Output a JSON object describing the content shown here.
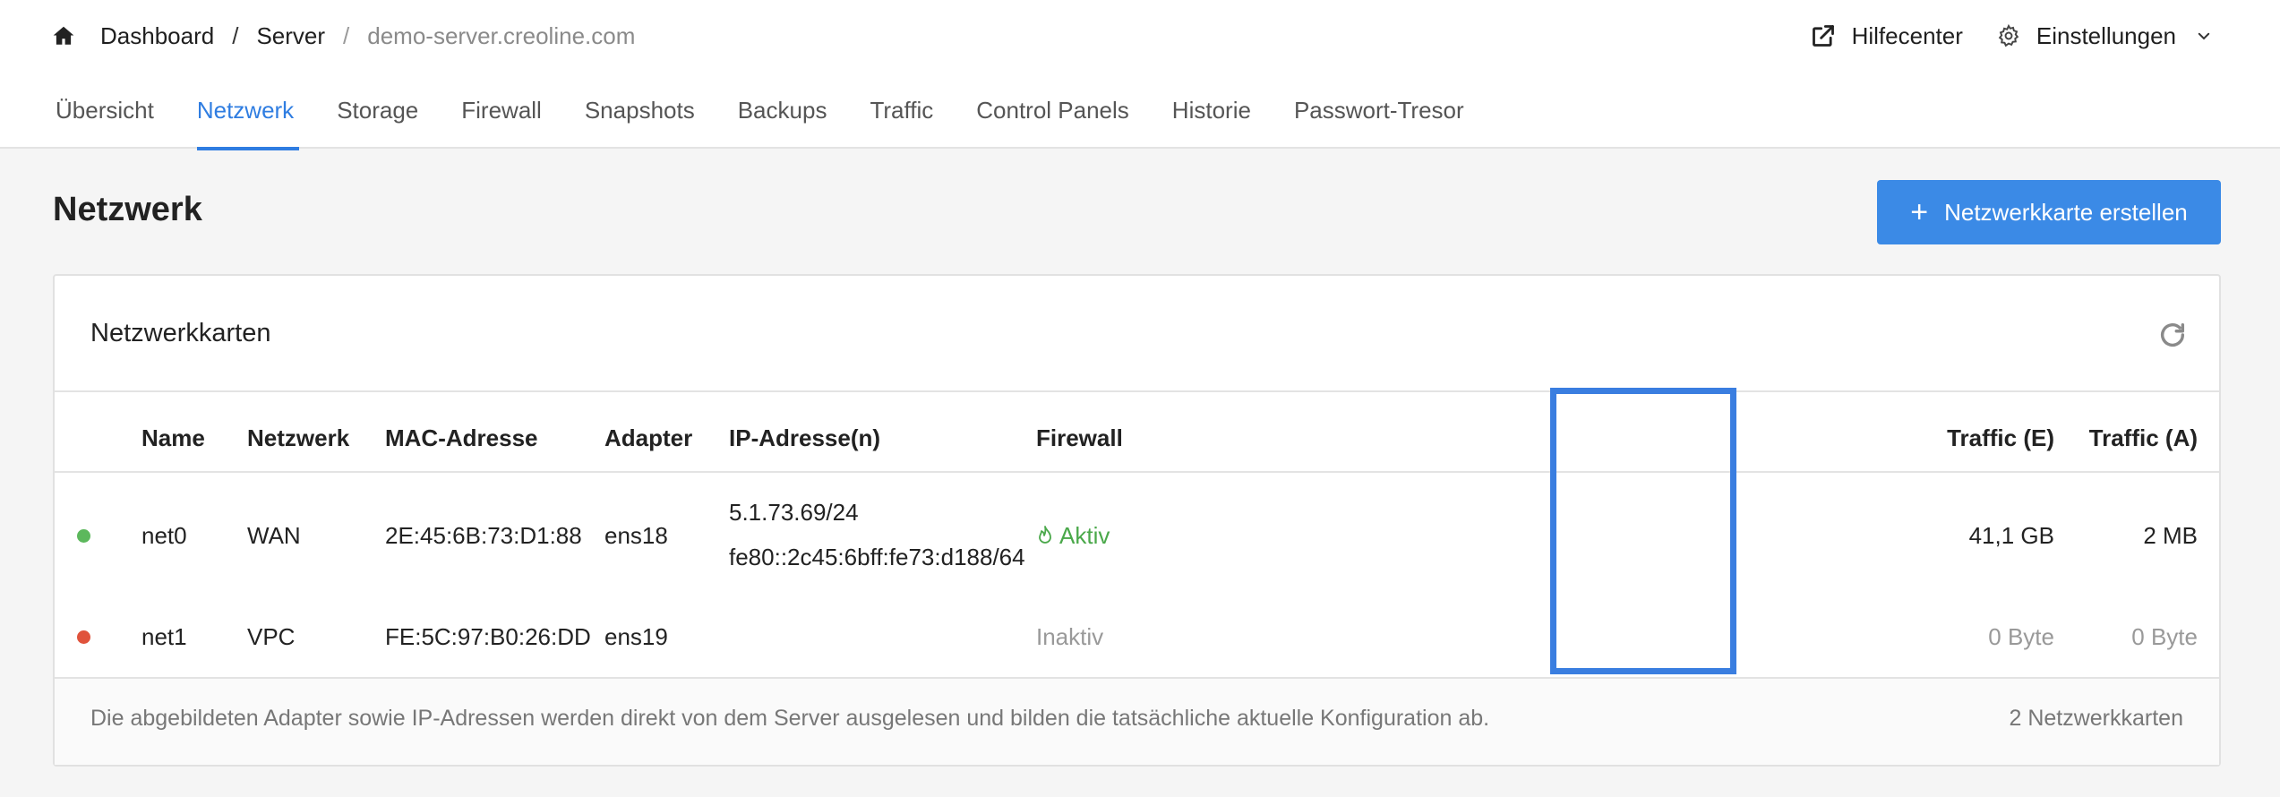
{
  "breadcrumb": {
    "items": [
      "Dashboard",
      "Server",
      "demo-server.creoline.com"
    ],
    "separator": "/"
  },
  "header_actions": {
    "help_label": "Hilfecenter",
    "settings_label": "Einstellungen"
  },
  "tabs": [
    {
      "label": "Übersicht",
      "active": false
    },
    {
      "label": "Netzwerk",
      "active": true
    },
    {
      "label": "Storage",
      "active": false
    },
    {
      "label": "Firewall",
      "active": false
    },
    {
      "label": "Snapshots",
      "active": false
    },
    {
      "label": "Backups",
      "active": false
    },
    {
      "label": "Traffic",
      "active": false
    },
    {
      "label": "Control Panels",
      "active": false
    },
    {
      "label": "Historie",
      "active": false
    },
    {
      "label": "Passwort-Tresor",
      "active": false
    }
  ],
  "page": {
    "title": "Netzwerk",
    "create_button_label": "Netzwerkkarte erstellen"
  },
  "card": {
    "title": "Netzwerkkarten",
    "columns": [
      "Name",
      "Netzwerk",
      "MAC-Adresse",
      "Adapter",
      "IP-Adresse(n)",
      "Firewall",
      "Traffic (E)",
      "Traffic (A)"
    ],
    "rows": [
      {
        "status_color": "#5cb85c",
        "name": "net0",
        "network": "WAN",
        "mac": "2E:45:6B:73:D1:88",
        "adapter": "ens18",
        "ips": [
          "5.1.73.69/24",
          "fe80::2c45:6bff:fe73:d188/64"
        ],
        "firewall": "Aktiv",
        "traffic_in": "41,1 GB",
        "traffic_out": "2 MB"
      },
      {
        "status_color": "#e0533c",
        "name": "net1",
        "network": "VPC",
        "mac": "FE:5C:97:B0:26:DD",
        "adapter": "ens19",
        "ips": [],
        "firewall": "Inaktiv",
        "traffic_in": "0 Byte",
        "traffic_out": "0 Byte"
      }
    ],
    "footer_text": "Die abgebildeten Adapter sowie IP-Adressen werden direkt von dem Server ausgelesen und bilden die tatsächliche aktuelle Konfiguration ab.",
    "footer_count": "2 Netzwerkkarten"
  },
  "colors": {
    "accent": "#3b8ae6",
    "active_tab": "#2f7de1",
    "firewall_active": "#4aa84a",
    "highlight_border": "#3a7ee0"
  }
}
